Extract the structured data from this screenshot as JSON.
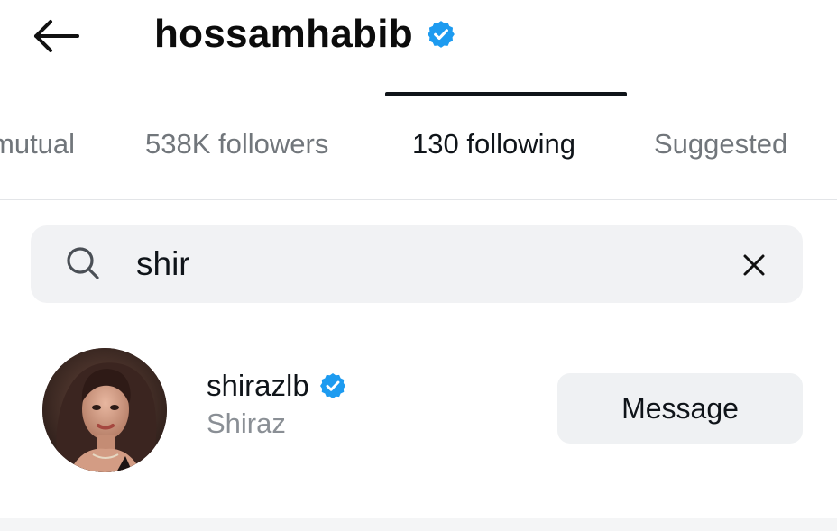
{
  "header": {
    "title": "hossamhabib",
    "back_icon": "arrow-left-icon",
    "verified_icon": "verified-badge-icon",
    "verified_color": "#1d9bf0"
  },
  "tabs": [
    {
      "label": "mutual",
      "active": false
    },
    {
      "label": "538K followers",
      "active": false
    },
    {
      "label": "130 following",
      "active": true
    },
    {
      "label": "Suggested",
      "active": false
    }
  ],
  "search": {
    "value": "shir",
    "icon": "search-icon",
    "clear_icon": "close-icon"
  },
  "results": [
    {
      "username": "shirazlb",
      "display_name": "Shiraz",
      "verified": true,
      "action_label": "Message"
    }
  ],
  "colors": {
    "text_primary": "#0f1419",
    "text_secondary": "#71767b",
    "search_bg": "#f1f2f4",
    "button_bg": "#eff1f3",
    "verified_blue": "#1d9bf0"
  }
}
